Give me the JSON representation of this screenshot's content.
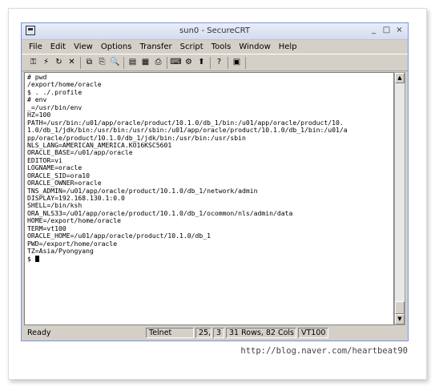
{
  "window": {
    "title": "sun0 - SecureCRT"
  },
  "title_buttons": [
    "_",
    "□",
    "×"
  ],
  "menu": [
    "File",
    "Edit",
    "View",
    "Options",
    "Transfer",
    "Script",
    "Tools",
    "Window",
    "Help"
  ],
  "toolbar_icons": [
    [
      "connect-icon",
      "quick-connect-icon",
      "reconnect-icon",
      "disconnect-icon"
    ],
    [
      "copy-icon",
      "paste-icon",
      "find-icon"
    ],
    [
      "session-options-icon",
      "global-options-icon",
      "print-icon"
    ],
    [
      "keymap-icon",
      "settings-icon",
      "upload-icon"
    ],
    [
      "help-icon"
    ],
    [
      "about-icon"
    ]
  ],
  "toolbar_glyphs": [
    [
      "⚿",
      "⚡",
      "↻",
      "✕"
    ],
    [
      "⧉",
      "⎘",
      "🔍"
    ],
    [
      "▤",
      "▦",
      "⎙"
    ],
    [
      "⌨",
      "⚙",
      "⬆"
    ],
    [
      "?"
    ],
    [
      "▣"
    ]
  ],
  "terminal": {
    "lines": [
      "# pwd",
      "/export/home/oracle",
      "$ . ./.profile",
      "# env",
      "_=/usr/bin/env",
      "HZ=100",
      "PATH=/usr/bin:/u01/app/oracle/product/10.1.0/db_1/bin:/u01/app/oracle/product/10.",
      "1.0/db_1/jdk/bin:/usr/bin:/usr/sbin:/u01/app/oracle/product/10.1.0/db_1/bin:/u01/a",
      "pp/oracle/product/10.1.0/db_1/jdk/bin:/usr/bin:/usr/sbin",
      "NLS_LANG=AMERICAN_AMERICA.KO16KSC5601",
      "ORACLE_BASE=/u01/app/oracle",
      "EDITOR=vi",
      "LOGNAME=oracle",
      "ORACLE_SID=ora10",
      "ORACLE_OWNER=oracle",
      "TNS_ADMIN=/u01/app/oracle/product/10.1.0/db_1/network/admin",
      "DISPLAY=192.168.130.1:0.0",
      "SHELL=/bin/ksh",
      "ORA_NLS33=/u01/app/oracle/product/10.1.0/db_1/ocommon/nls/admin/data",
      "HOME=/export/home/oracle",
      "TERM=vt100",
      "ORACLE_HOME=/u01/app/oracle/product/10.1.0/db_1",
      "PWD=/export/home/oracle",
      "TZ=Asia/Pyongyang"
    ],
    "prompt": "$ "
  },
  "status": {
    "ready": "Ready",
    "protocol": "Telnet",
    "row": "25,",
    "col": "3",
    "size": "31 Rows, 82 Cols",
    "emulation": "VT100"
  },
  "watermark": "http://blog.naver.com/heartbeat90"
}
